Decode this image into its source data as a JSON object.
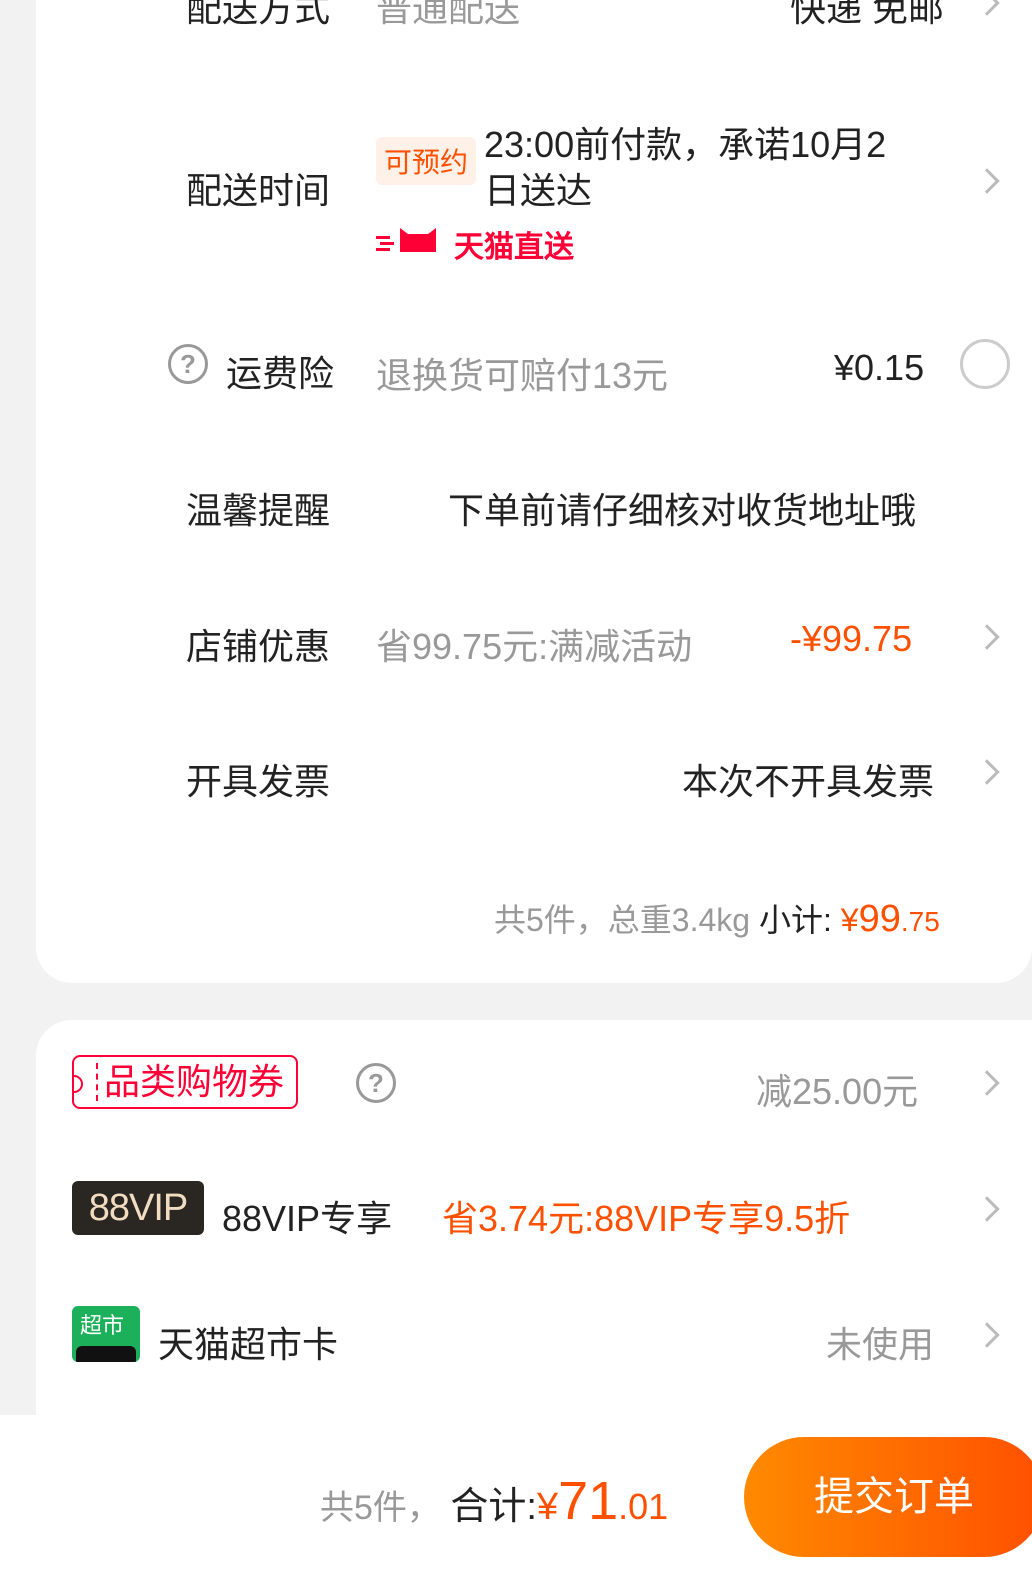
{
  "order_card": {
    "delivery_method": {
      "label": "配送方式",
      "value": "普通配送",
      "right": "快递 免邮"
    },
    "delivery_time": {
      "label": "配送时间",
      "tag": "可预约",
      "line1": "23:00前付款，承诺10月2",
      "line2": "日送达",
      "brand": "天猫直送"
    },
    "freight_insurance": {
      "label": "运费险",
      "desc": "退换货可赔付13元",
      "price": "¥0.15"
    },
    "reminder": {
      "label": "温馨提醒",
      "text": "下单前请仔细核对收货地址哦"
    },
    "store_discount": {
      "label": "店铺优惠",
      "desc": "省99.75元:满减活动",
      "amount": "-¥99.75"
    },
    "invoice": {
      "label": "开具发票",
      "value": "本次不开具发票"
    },
    "summary": {
      "count_weight": "共5件，总重3.4kg",
      "subtotal_label": "小计:",
      "currency": "¥",
      "int": "99",
      "dec": ".75"
    }
  },
  "benefits_card": {
    "coupon": {
      "tag": "品类购物券",
      "value": "减25.00元"
    },
    "vip": {
      "badge": "88VIP",
      "label": "88VIP专享",
      "desc": "省3.74元:88VIP专享9.5折"
    },
    "market_card": {
      "icon_text": "超市",
      "label": "天猫超市卡",
      "value": "未使用"
    }
  },
  "bottom_bar": {
    "count": "共5件，",
    "total_label": "合计:",
    "currency": "¥",
    "int": "71",
    "dec": ".01",
    "submit_label": "提交订单"
  },
  "colors": {
    "accent": "#ff5000",
    "tmall_red": "#ff0036",
    "vip_dark": "#2a2622",
    "market_green": "#1db05a"
  },
  "icons": [
    "chevron-right-icon",
    "help-icon",
    "radio-circle-icon",
    "tmall-cat-logo"
  ]
}
